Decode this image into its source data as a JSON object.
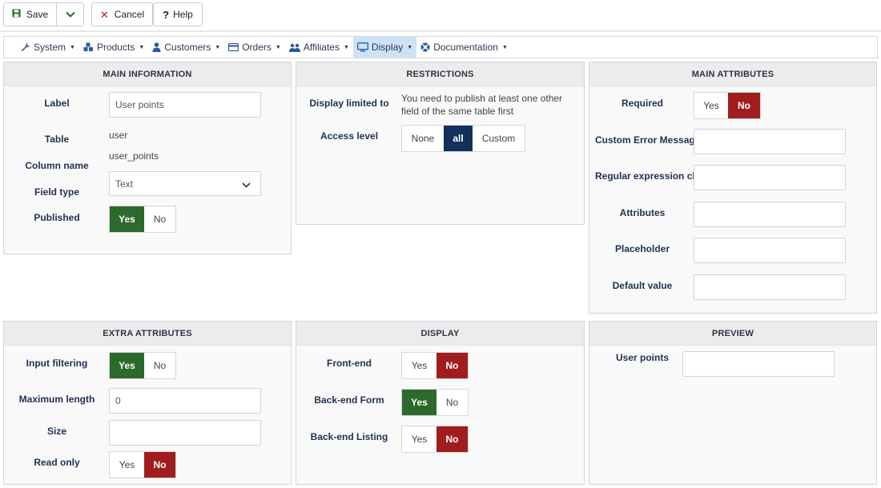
{
  "toolbar": {
    "save": "Save",
    "cancel": "Cancel",
    "help": "Help"
  },
  "menu": [
    {
      "label": "System",
      "icon": "wrench-icon"
    },
    {
      "label": "Products",
      "icon": "cubes-icon"
    },
    {
      "label": "Customers",
      "icon": "user-icon"
    },
    {
      "label": "Orders",
      "icon": "credit-card-icon"
    },
    {
      "label": "Affiliates",
      "icon": "users-icon"
    },
    {
      "label": "Display",
      "icon": "monitor-icon",
      "active": true
    },
    {
      "label": "Documentation",
      "icon": "lifebuoy-icon"
    }
  ],
  "main_info": {
    "title": "MAIN INFORMATION",
    "label_lbl": "Label",
    "label_value": "User points",
    "table_lbl": "Table",
    "table_value": "user",
    "column_lbl": "Column name",
    "column_value": "user_points",
    "fieldtype_lbl": "Field type",
    "fieldtype_value": "Text",
    "published_lbl": "Published",
    "yes": "Yes",
    "no": "No"
  },
  "restrictions": {
    "title": "RESTRICTIONS",
    "display_lbl": "Display limited to",
    "display_note": "You need to publish at least one other field of the same table first",
    "access_lbl": "Access level",
    "access_options": [
      "None",
      "all",
      "Custom"
    ],
    "access_selected": "all"
  },
  "main_attributes": {
    "title": "MAIN ATTRIBUTES",
    "required_lbl": "Required",
    "yes": "Yes",
    "no": "No",
    "custom_error_lbl": "Custom Error Message",
    "regex_lbl": "Regular expression che",
    "attributes_lbl": "Attributes",
    "placeholder_lbl": "Placeholder",
    "default_lbl": "Default value"
  },
  "extra_attributes": {
    "title": "EXTRA ATTRIBUTES",
    "input_filtering_lbl": "Input filtering",
    "max_length_lbl": "Maximum length",
    "max_length_value": "0",
    "size_lbl": "Size",
    "readonly_lbl": "Read only",
    "yes": "Yes",
    "no": "No"
  },
  "display": {
    "title": "DISPLAY",
    "frontend_lbl": "Front-end",
    "backend_form_lbl": "Back-end Form",
    "backend_listing_lbl": "Back-end Listing",
    "yes": "Yes",
    "no": "No"
  },
  "preview": {
    "title": "PREVIEW",
    "field_lbl": "User points"
  },
  "colors": {
    "green": "#2b6a2b",
    "red": "#a11d1d",
    "navy": "#12305a",
    "active_menu": "#cde3f5"
  }
}
